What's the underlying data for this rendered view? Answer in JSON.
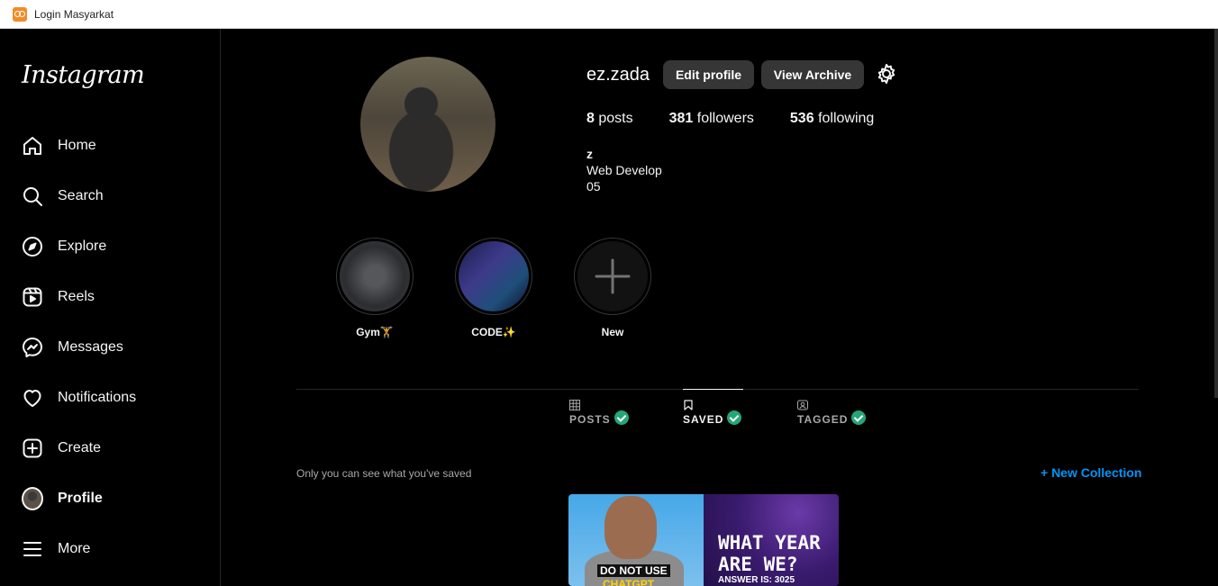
{
  "window": {
    "title": "Login Masyarkat"
  },
  "sidebar": {
    "logo": "Instagram",
    "items": [
      {
        "label": "Home",
        "icon": "home-icon"
      },
      {
        "label": "Search",
        "icon": "search-icon"
      },
      {
        "label": "Explore",
        "icon": "compass-icon"
      },
      {
        "label": "Reels",
        "icon": "reels-icon"
      },
      {
        "label": "Messages",
        "icon": "messenger-icon"
      },
      {
        "label": "Notifications",
        "icon": "heart-icon"
      },
      {
        "label": "Create",
        "icon": "plus-square-icon"
      },
      {
        "label": "Profile",
        "icon": "avatar"
      },
      {
        "label": "More",
        "icon": "menu-icon"
      }
    ]
  },
  "profile": {
    "username": "ez.zada",
    "edit_label": "Edit profile",
    "archive_label": "View Archive",
    "stats": {
      "posts_count": "8",
      "posts_label": "posts",
      "followers_count": "381",
      "followers_label": "followers",
      "following_count": "536",
      "following_label": "following"
    },
    "bio": {
      "name": "z",
      "line1": "Web Develop",
      "line2": "05"
    }
  },
  "highlights": [
    {
      "label": "Gym🏋"
    },
    {
      "label": "CODE✨"
    },
    {
      "label": "New"
    }
  ],
  "tabs": [
    {
      "label": "POSTS",
      "icon": "grid-icon"
    },
    {
      "label": "SAVED",
      "icon": "bookmark-icon",
      "active": true
    },
    {
      "label": "TAGGED",
      "icon": "tag-user-icon"
    }
  ],
  "saved": {
    "note": "Only you can see what you've saved",
    "new_collection": "+ New Collection",
    "thumb1_caption_1": "DO NOT USE",
    "thumb1_caption_2": "CHATGPT",
    "thumb2_title_1": "WHAT YEAR",
    "thumb2_title_2": "ARE WE?",
    "thumb2_answer": "ANSWER IS: 3025"
  },
  "colors": {
    "accent": "#0095f6",
    "check": "#25a57c",
    "button": "#363636"
  }
}
